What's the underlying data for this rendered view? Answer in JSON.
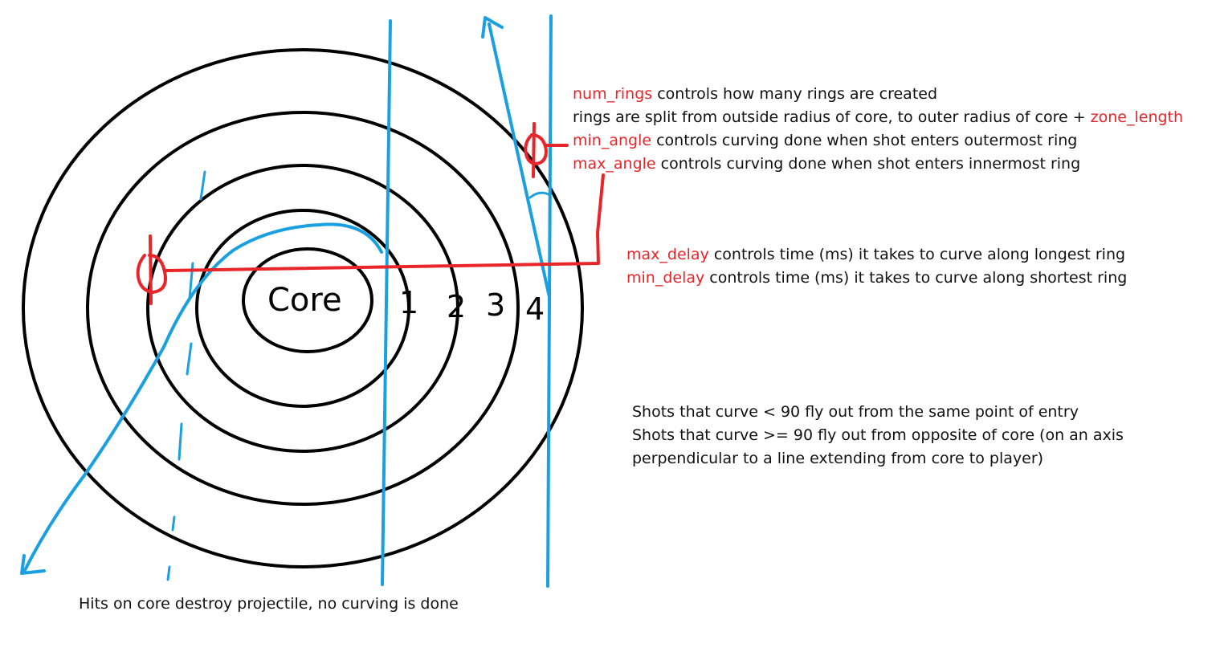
{
  "colors": {
    "rings": "#000000",
    "shot_paths": "#1aa0e0",
    "measure_marks": "#e8262a",
    "keyword_text": "#e8262a",
    "body_text": "#111111"
  },
  "diagram": {
    "core_label": "Core",
    "ring_labels": [
      "1",
      "2",
      "3",
      "4"
    ]
  },
  "notes": {
    "ring_config": {
      "line1": {
        "kw": "num_rings",
        "text": " controls how many rings are created"
      },
      "line2": {
        "text": "rings are split from outside radius of core, to outer radius of core + ",
        "kw": "zone_length"
      },
      "line3": {
        "kw": "min_angle",
        "text": " controls curving done when shot enters outermost ring"
      },
      "line4": {
        "kw": "max_angle",
        "text": " controls curving done when shot enters innermost ring"
      }
    },
    "delay_config": {
      "line1": {
        "kw": "max_delay",
        "text": " controls time (ms) it takes to curve along longest ring"
      },
      "line2": {
        "kw": "min_delay",
        "text": " controls time (ms) it takes to curve along shortest ring"
      }
    },
    "exit_behavior": {
      "line1": "Shots that curve < 90 fly out from the same point of entry",
      "line2": "Shots that curve >= 90 fly out from opposite of core (on an axis",
      "line3": "perpendicular to a line extending from core to player)"
    },
    "core_hit": "Hits on core destroy projectile, no curving is done"
  }
}
